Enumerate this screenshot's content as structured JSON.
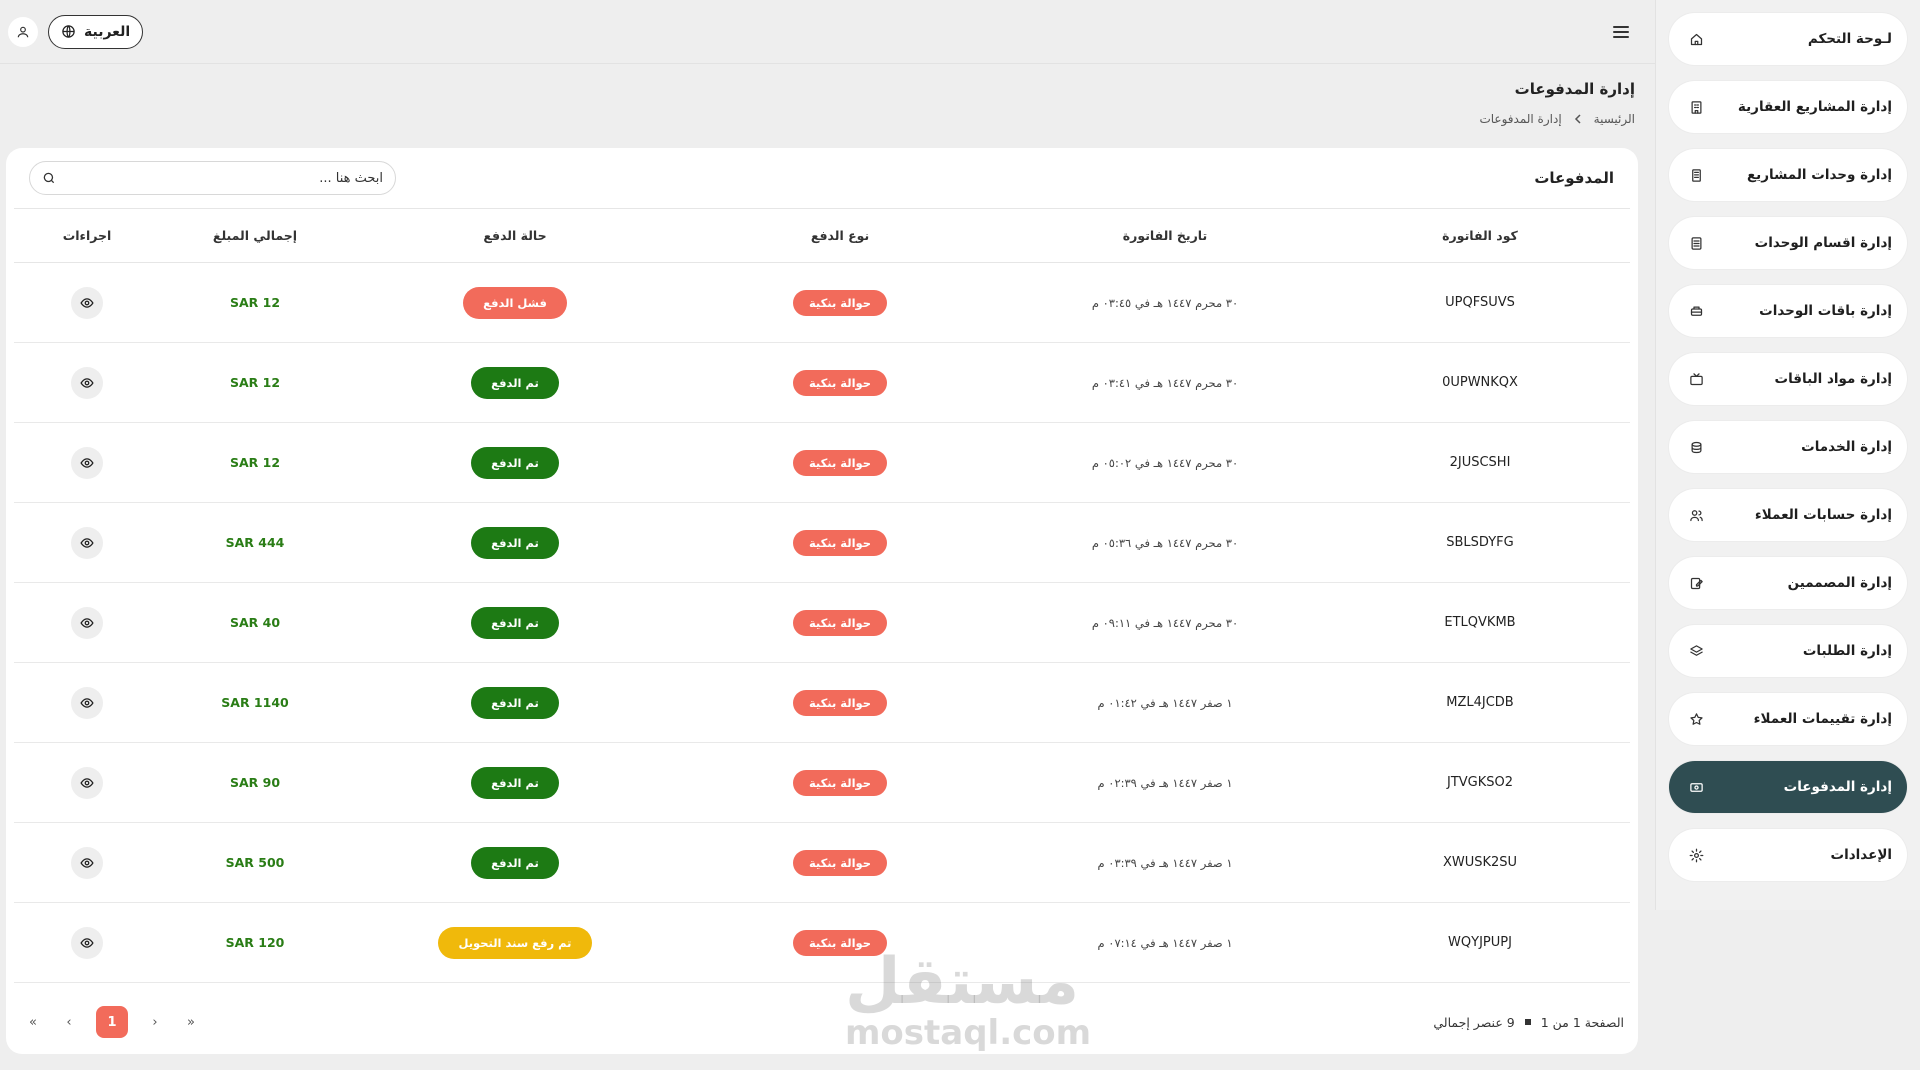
{
  "sidebar": {
    "items": [
      {
        "label": "لـوحة التحكم",
        "icon": "home-icon"
      },
      {
        "label": "إدارة المشاريع العقارية",
        "icon": "building-icon"
      },
      {
        "label": "إدارة وحدات المشاريع",
        "icon": "units-icon"
      },
      {
        "label": "إدارة اقسام الوحدات",
        "icon": "list-icon"
      },
      {
        "label": "إدارة باقات الوحدات",
        "icon": "package-icon"
      },
      {
        "label": "إدارة مواد الباقات",
        "icon": "tv-icon"
      },
      {
        "label": "إدارة الخدمات",
        "icon": "service-icon"
      },
      {
        "label": "إدارة حسابات العملاء",
        "icon": "users-icon"
      },
      {
        "label": "إدارة المصممين",
        "icon": "designer-icon"
      },
      {
        "label": "إدارة الطلبات",
        "icon": "layers-icon"
      },
      {
        "label": "إدارة تقييمات العملاء",
        "icon": "star-icon"
      },
      {
        "label": "إدارة المدفوعات",
        "icon": "payment-icon",
        "active": true
      },
      {
        "label": "الإعدادات",
        "icon": "gear-icon"
      }
    ]
  },
  "topbar": {
    "language_label": "العربية"
  },
  "header": {
    "title": "إدارة المدفوعات",
    "breadcrumb": {
      "home": "الرئيسية",
      "current": "إدارة المدفوعات"
    }
  },
  "card": {
    "title": "المدفوعات",
    "search": {
      "placeholder": "ابحث هنا ..."
    },
    "columns": {
      "code": "كود الفاتورة",
      "date": "تاريخ الفاتورة",
      "type": "نوع الدفع",
      "status": "حالة الدفع",
      "amount": "إجمالي المبلغ",
      "actions": "اجراءات"
    },
    "rows": [
      {
        "code": "UPQFSUVS",
        "date": "٣٠ محرم ١٤٤٧ هـ في ٠٣:٤٥ م",
        "type": "حوالة بنكية",
        "status": "فشل الدفع",
        "status_kind": "failed",
        "amount": "SAR 12"
      },
      {
        "code": "0UPWNKQX",
        "date": "٣٠ محرم ١٤٤٧ هـ في ٠٣:٤١ م",
        "type": "حوالة بنكية",
        "status": "تم الدفع",
        "status_kind": "paid",
        "amount": "SAR 12"
      },
      {
        "code": "2JUSCSHI",
        "date": "٣٠ محرم ١٤٤٧ هـ في ٠٥:٠٢ م",
        "type": "حوالة بنكية",
        "status": "تم الدفع",
        "status_kind": "paid",
        "amount": "SAR 12"
      },
      {
        "code": "SBLSDYFG",
        "date": "٣٠ محرم ١٤٤٧ هـ في ٠٥:٣٦ م",
        "type": "حوالة بنكية",
        "status": "تم الدفع",
        "status_kind": "paid",
        "amount": "SAR 444"
      },
      {
        "code": "ETLQVKMB",
        "date": "٣٠ محرم ١٤٤٧ هـ في ٠٩:١١ م",
        "type": "حوالة بنكية",
        "status": "تم الدفع",
        "status_kind": "paid",
        "amount": "SAR 40"
      },
      {
        "code": "MZL4JCDB",
        "date": "١ صفر ١٤٤٧ هـ في ٠١:٤٢ م",
        "type": "حوالة بنكية",
        "status": "تم الدفع",
        "status_kind": "paid",
        "amount": "SAR 1140"
      },
      {
        "code": "JTVGKSO2",
        "date": "١ صفر ١٤٤٧ هـ في ٠٢:٣٩ م",
        "type": "حوالة بنكية",
        "status": "تم الدفع",
        "status_kind": "paid",
        "amount": "SAR 90"
      },
      {
        "code": "XWUSK2SU",
        "date": "١ صفر ١٤٤٧ هـ في ٠٣:٣٩ م",
        "type": "حوالة بنكية",
        "status": "تم الدفع",
        "status_kind": "paid",
        "amount": "SAR 500"
      },
      {
        "code": "WQYJPUPJ",
        "date": "١ صفر ١٤٤٧ هـ في ٠٧:١٤ م",
        "type": "حوالة بنكية",
        "status": "تم رفع سند التحويل",
        "status_kind": "pending",
        "amount": "SAR 120"
      }
    ]
  },
  "footer": {
    "page_info": "الصفحة 1 من 1",
    "total_info": "9 عنصر إجمالي",
    "current_page": "1",
    "first_label": "«",
    "prev_label": "‹",
    "next_label": "›",
    "last_label": "»"
  },
  "watermark": {
    "ar": "مستقل",
    "en": "mostaql.com"
  },
  "colors": {
    "accent": "#f26b5b",
    "active_nav": "#2f4d52",
    "paid": "#1d7a14",
    "pending": "#f0b90b",
    "amount": "#2a7d16"
  }
}
